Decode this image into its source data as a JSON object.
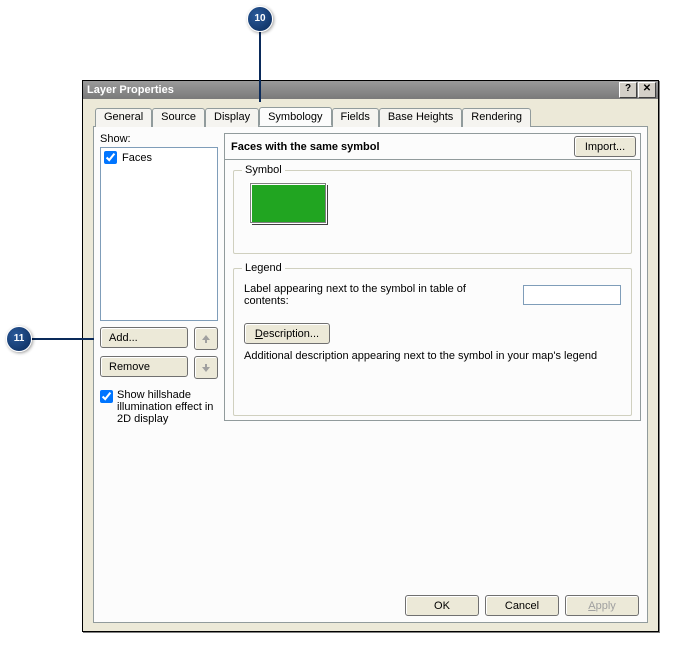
{
  "callouts": {
    "c10": "10",
    "c11": "11"
  },
  "window": {
    "title": "Layer Properties"
  },
  "tabs": {
    "general": "General",
    "source": "Source",
    "display": "Display",
    "symbology": "Symbology",
    "fields": "Fields",
    "baseheights": "Base Heights",
    "rendering": "Rendering"
  },
  "left": {
    "show_label": "Show:",
    "item_faces": "Faces",
    "add": "Add...",
    "remove": "Remove",
    "hillshade": "Show hillshade illumination effect in 2D display"
  },
  "right": {
    "header_title": "Faces with the same symbol",
    "import": "Import...",
    "symbol_group": "Symbol",
    "legend_group": "Legend",
    "legend_label": "Label appearing next to the symbol in table of contents:",
    "legend_value": "",
    "description_btn": "Description...",
    "description_text": "Additional description appearing next to the symbol in your map's legend"
  },
  "buttons": {
    "ok": "OK",
    "cancel": "Cancel",
    "apply": "Apply"
  }
}
